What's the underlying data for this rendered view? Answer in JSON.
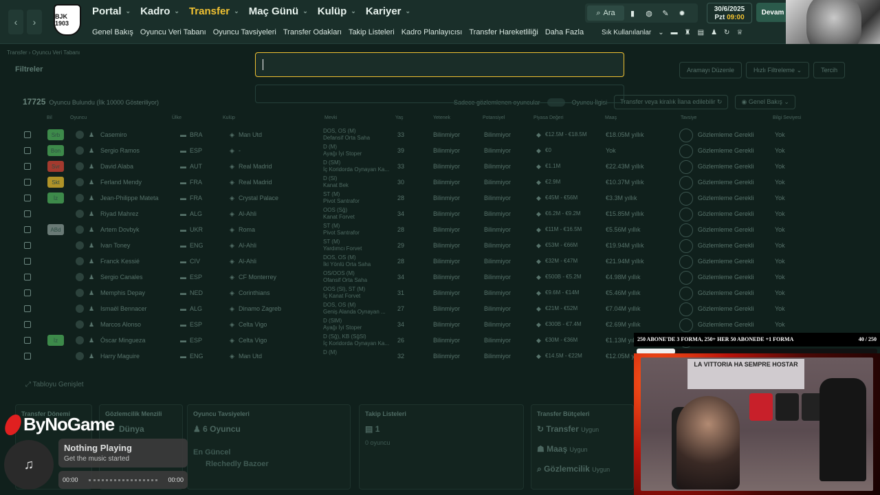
{
  "nav": {
    "back_icon": "chevron-left-icon",
    "forward_icon": "chevron-right-icon",
    "logo_text": "BJK 1903",
    "main_items": [
      {
        "label": "Portal",
        "active": false
      },
      {
        "label": "Kadro",
        "active": false
      },
      {
        "label": "Transfer",
        "active": true
      },
      {
        "label": "Maç Günü",
        "active": false
      },
      {
        "label": "Kulüp",
        "active": false
      },
      {
        "label": "Kariyer",
        "active": false
      }
    ],
    "sub_items": [
      "Genel Bakış",
      "Oyuncu Veri Tabanı",
      "Oyuncu Tavsiyeleri",
      "Transfer Odakları",
      "Takip Listeleri",
      "Kadro Planlayıcısı",
      "Transfer Hareketliliği",
      "Daha Fazla"
    ],
    "search_label": "Ara",
    "date": "30/6/2025",
    "day": "Pzt",
    "time": "09:00",
    "continue_label": "Devam",
    "favorites_label": "Sık Kullanılanlar"
  },
  "breadcrumb": "Transfer › Oyuncu Veri Tabanı",
  "filters_title": "Filtreler",
  "actions": {
    "edit_search": "Aramayı Düzenle",
    "quick_filter": "Hızlı Filtreleme",
    "retry": "Tercih"
  },
  "found": {
    "count": "17725",
    "label": "Oyuncu Bulundu (İlk 10000 Gösteriliyor)"
  },
  "options": {
    "scouted_toggle": "Sadece gözlemlenen oyuncular",
    "interest": "Oyuncu İlgisi",
    "transfer_status": "Transfer veya kiralık",
    "transfer_status_suffix": "İlana edilebilir",
    "view": "Genel Bakış"
  },
  "search": {
    "value": "",
    "placeholder": ""
  },
  "columns": [
    "Bil",
    "Oyuncu",
    "Ülke",
    "Kulüp",
    "Mevki",
    "Yaş",
    "Yetenek",
    "Potansiyel",
    "Piyasa Değeri",
    "Maaş",
    "Tavsiye",
    "Bilgi Seviyesi"
  ],
  "players": [
    {
      "role": "Srb",
      "role_color": "#3d8a4a",
      "name": "Casemiro",
      "nat": "BRA",
      "club": "Man Utd",
      "pos1": "DOS, OS (M)",
      "pos2": "Defansif Orta Saha",
      "age": "33",
      "ability": "Bilinmiyor",
      "potential": "Bilinmiyor",
      "value": "€12.5M - €18.5M",
      "wage": "€18.05M yıllık",
      "advice": "Gözlemleme Gerekli",
      "info": "Yok"
    },
    {
      "role": "Bon",
      "role_color": "#3d8a4a",
      "name": "Sergio Ramos",
      "nat": "ESP",
      "club": "-",
      "pos1": "D (M)",
      "pos2": "Ayağı İyi Stoper",
      "age": "39",
      "ability": "Bilinmiyor",
      "potential": "Bilinmiyor",
      "value": "€0",
      "wage": "Yok",
      "advice": "Gözlemleme Gerekli",
      "info": "Yok"
    },
    {
      "role": "Svr",
      "role_color": "#a33a2e",
      "name": "David Alaba",
      "nat": "AUT",
      "club": "Real Madrid",
      "pos1": "D (SM)",
      "pos2": "İç Koridorda Oynayan Ka...",
      "age": "33",
      "ability": "Bilinmiyor",
      "potential": "Bilinmiyor",
      "value": "€1.1M",
      "wage": "€22.43M yıllık",
      "advice": "Gözlemleme Gerekli",
      "info": "Yok"
    },
    {
      "role": "Skt",
      "role_color": "#b09328",
      "name": "Ferland Mendy",
      "nat": "FRA",
      "club": "Real Madrid",
      "pos1": "D (Sl)",
      "pos2": "Kanat Bek",
      "age": "30",
      "ability": "Bilinmiyor",
      "potential": "Bilinmiyor",
      "value": "€2.9M",
      "wage": "€10.37M yıllık",
      "advice": "Gözlemleme Gerekli",
      "info": "Yok"
    },
    {
      "role": "İz",
      "role_color": "#3d8a4a",
      "name": "Jean-Philippe Mateta",
      "nat": "FRA",
      "club": "Crystal Palace",
      "pos1": "ST (M)",
      "pos2": "Pivot Santrafor",
      "age": "28",
      "ability": "Bilinmiyor",
      "potential": "Bilinmiyor",
      "value": "€45M - €56M",
      "wage": "€3.3M yıllık",
      "advice": "Gözlemleme Gerekli",
      "info": "Yok"
    },
    {
      "role": "",
      "role_color": "",
      "name": "Riyad Mahrez",
      "nat": "ALG",
      "club": "Al-Ahli",
      "pos1": "OOS (Sğ)",
      "pos2": "Kanat Forvet",
      "age": "34",
      "ability": "Bilinmiyor",
      "potential": "Bilinmiyor",
      "value": "€6.2M - €9.2M",
      "wage": "€15.85M yıllık",
      "advice": "Gözlemleme Gerekli",
      "info": "Yok"
    },
    {
      "role": "ABd",
      "role_color": "#6a7a76",
      "name": "Artem Dovbyk",
      "nat": "UKR",
      "club": "Roma",
      "pos1": "ST (M)",
      "pos2": "Pivot Santrafor",
      "age": "28",
      "ability": "Bilinmiyor",
      "potential": "Bilinmiyor",
      "value": "€11M - €16.5M",
      "wage": "€5.56M yıllık",
      "advice": "Gözlemleme Gerekli",
      "info": "Yok"
    },
    {
      "role": "",
      "role_color": "",
      "name": "Ivan Toney",
      "nat": "ENG",
      "club": "Al-Ahli",
      "pos1": "ST (M)",
      "pos2": "Yardımcı Forvet",
      "age": "29",
      "ability": "Bilinmiyor",
      "potential": "Bilinmiyor",
      "value": "€53M - €66M",
      "wage": "€19.94M yıllık",
      "advice": "Gözlemleme Gerekli",
      "info": "Yok"
    },
    {
      "role": "",
      "role_color": "",
      "name": "Franck Kessié",
      "nat": "CIV",
      "club": "Al-Ahli",
      "pos1": "DOS, OS (M)",
      "pos2": "İki Yönlü Orta Saha",
      "age": "28",
      "ability": "Bilinmiyor",
      "potential": "Bilinmiyor",
      "value": "€32M - €47M",
      "wage": "€21.94M yıllık",
      "advice": "Gözlemleme Gerekli",
      "info": "Yok"
    },
    {
      "role": "",
      "role_color": "",
      "name": "Sergio Canales",
      "nat": "ESP",
      "club": "CF Monterrey",
      "pos1": "OS/OOS (M)",
      "pos2": "Ofansif Orta Saha",
      "age": "34",
      "ability": "Bilinmiyor",
      "potential": "Bilinmiyor",
      "value": "€500B - €5.2M",
      "wage": "€4.98M yıllık",
      "advice": "Gözlemleme Gerekli",
      "info": "Yok"
    },
    {
      "role": "",
      "role_color": "",
      "name": "Memphis Depay",
      "nat": "NED",
      "club": "Corinthians",
      "pos1": "OOS (Sl), ST (M)",
      "pos2": "İç Kanat Forvet",
      "age": "31",
      "ability": "Bilinmiyor",
      "potential": "Bilinmiyor",
      "value": "€9.6M - €14M",
      "wage": "€5.46M yıllık",
      "advice": "Gözlemleme Gerekli",
      "info": "Yok"
    },
    {
      "role": "",
      "role_color": "",
      "name": "Ismaël Bennacer",
      "nat": "ALG",
      "club": "Dinamo Zagreb",
      "pos1": "DOS, OS (M)",
      "pos2": "Geniş Alanda Oynayan ...",
      "age": "27",
      "ability": "Bilinmiyor",
      "potential": "Bilinmiyor",
      "value": "€21M - €52M",
      "wage": "€7.04M yıllık",
      "advice": "Gözlemleme Gerekli",
      "info": "Yok"
    },
    {
      "role": "",
      "role_color": "",
      "name": "Marcos Alonso",
      "nat": "ESP",
      "club": "Celta Vigo",
      "pos1": "D (SlM)",
      "pos2": "Ayağı İyi Stoper",
      "age": "34",
      "ability": "Bilinmiyor",
      "potential": "Bilinmiyor",
      "value": "€300B - €7.4M",
      "wage": "€2.69M yıllık",
      "advice": "Gözlemleme Gerekli",
      "info": "Yok"
    },
    {
      "role": "İz",
      "role_color": "#3d8a4a",
      "name": "Óscar Mingueza",
      "nat": "ESP",
      "club": "Celta Vigo",
      "pos1": "D (Sğ), KB (SğSl)",
      "pos2": "İç Koridorda Oynayan Ka...",
      "age": "26",
      "ability": "Bilinmiyor",
      "potential": "Bilinmiyor",
      "value": "€30M - €36M",
      "wage": "€1.13M yıllık",
      "advice": "Gözlemleme Gerekli",
      "info": "Yok"
    },
    {
      "role": "",
      "role_color": "",
      "name": "Harry Maguire",
      "nat": "ENG",
      "club": "Man Utd",
      "pos1": "D (M)",
      "pos2": "",
      "age": "32",
      "ability": "Bilinmiyor",
      "potential": "Bilinmiyor",
      "value": "€14.5M - €22M",
      "wage": "€12.05M yıllık",
      "advice": "Gözlemleme Gerekli",
      "info": "Yok"
    }
  ],
  "expand_table": "Tabloyu Genişlet",
  "cards": {
    "transfer_period": {
      "title": "Transfer Dönemi"
    },
    "scouting_range": {
      "title": "Gözlemcilik Menzili",
      "value": "Dünya"
    },
    "recommendations": {
      "title": "Oyuncu Tavsiyeleri",
      "value": "6 Oyuncu",
      "latest_label": "En Güncel",
      "latest_name": "Rlechedly Bazoer"
    },
    "watchlists": {
      "title": "Takip Listeleri",
      "value": "1",
      "sub": "0 oyuncu"
    },
    "budgets": {
      "title": "Transfer Bütçeleri",
      "rows": [
        {
          "label": "Transfer",
          "status": "Uygun"
        },
        {
          "label": "Maaş",
          "status": "Uygun"
        },
        {
          "label": "Gözlemcilik",
          "status": "Uygun"
        }
      ]
    }
  },
  "overlay": {
    "brand": "ByNoGame",
    "music_title": "Nothing Playing",
    "music_sub": "Get the music started",
    "time_start": "00:00",
    "time_end": "00:00",
    "subs_goal": "250 ABONE'DE 3 FORMA, 250+ HER 50 ABONEDE +1 FORMA",
    "subs_progress": "40 / 250",
    "subs_fraction": 0.16,
    "cam_banner": "LA VITTORIA HA SEMPRE HOSTAR"
  }
}
